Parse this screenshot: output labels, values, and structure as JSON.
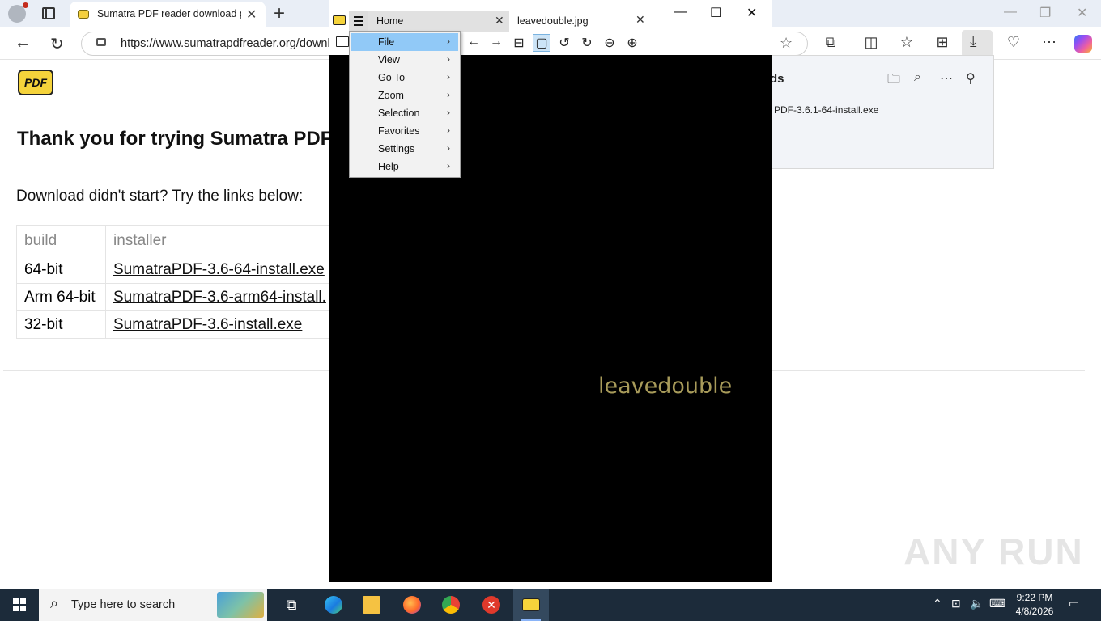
{
  "browser": {
    "tab_title": "Sumatra PDF reader download pa",
    "url": "https://www.sumatrapdfreader.org/downl"
  },
  "page": {
    "logo_text": "PDF",
    "heading": "Thank you for trying Sumatra PDF.",
    "subtext": "Download didn't start? Try the links below:",
    "table": {
      "headers": [
        "build",
        "installer"
      ],
      "rows": [
        {
          "build": "64-bit",
          "installer": "SumatraPDF-3.6-64-install.exe"
        },
        {
          "build": "Arm 64-bit",
          "installer": "SumatraPDF-3.6-arm64-install."
        },
        {
          "build": "32-bit",
          "installer": "SumatraPDF-3.6-install.exe"
        }
      ]
    }
  },
  "downloads_panel": {
    "title_fragment": "ds",
    "file": "PDF-3.6.1-64-install.exe"
  },
  "sumatra": {
    "tab_home": "Home",
    "tab_doc": "leavedouble.jpg",
    "doc_text": "leavedouble",
    "menu": {
      "items": [
        "File",
        "View",
        "Go To",
        "Zoom",
        "Selection",
        "Favorites",
        "Settings",
        "Help"
      ],
      "highlighted": "File"
    }
  },
  "watermark": "ANY RUN",
  "taskbar": {
    "search_placeholder": "Type here to search",
    "time": "9:22 PM",
    "date": "4/8/2026"
  }
}
